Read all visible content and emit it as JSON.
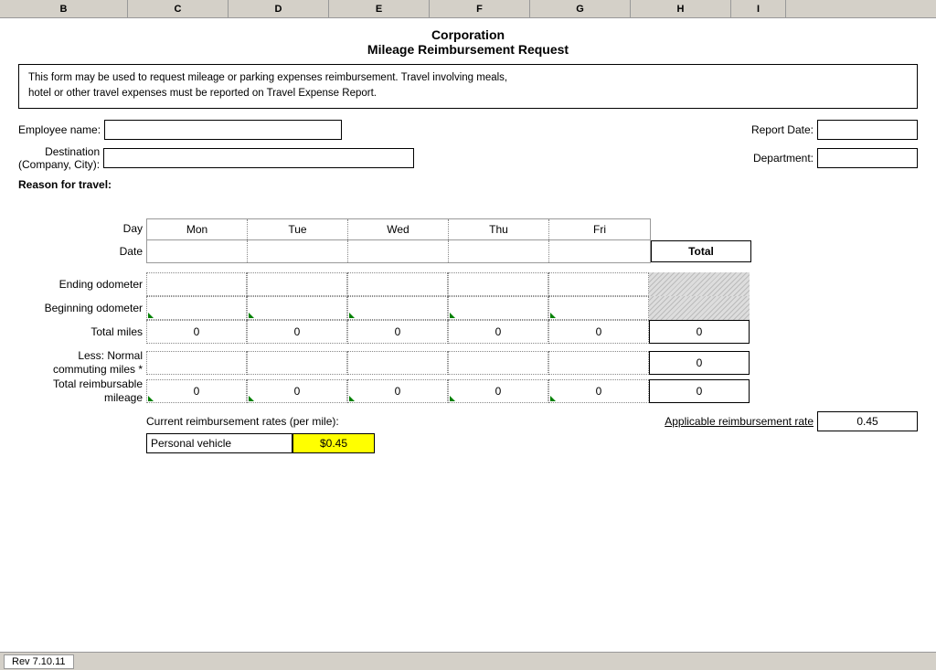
{
  "spreadsheet": {
    "columns": [
      "B",
      "C",
      "D",
      "E",
      "F",
      "G",
      "H",
      "I"
    ],
    "title_line1": "Corporation",
    "title_line2": "Mileage Reimbursement Request",
    "info_text_line1": "This form may be used to request mileage or parking expenses reimbursement.  Travel involving meals,",
    "info_text_line2": "hotel or other travel expenses must be reported on Travel Expense Report.",
    "employee_name_label": "Employee name:",
    "report_date_label": "Report Date:",
    "destination_label": "Destination\n(Company, City):",
    "department_label": "Department:",
    "reason_label": "Reason for travel:",
    "day_label": "Day",
    "date_label": "Date",
    "days": [
      "Mon",
      "Tue",
      "Wed",
      "Thu",
      "Fri"
    ],
    "total_label": "Total",
    "ending_odometer_label": "Ending odometer",
    "beginning_odometer_label": "Beginning odometer",
    "total_miles_label": "Total miles",
    "total_miles_values": [
      "0",
      "0",
      "0",
      "0",
      "0",
      "0"
    ],
    "less_commuting_label": "Less: Normal\ncommuting miles *",
    "less_commuting_total": "0",
    "total_reimbursable_label": "Total reimbursable\nmileage",
    "total_reimbursable_values": [
      "0",
      "0",
      "0",
      "0",
      "0",
      "0"
    ],
    "current_rates_label": "Current reimbursement rates (per mile):",
    "applicable_rate_label": "Applicable reimbursement rate",
    "applicable_rate_value": "0.45",
    "personal_vehicle_label": "Personal vehicle",
    "personal_vehicle_value": "$0.45",
    "tab_label": "Rev 7.10.11"
  }
}
